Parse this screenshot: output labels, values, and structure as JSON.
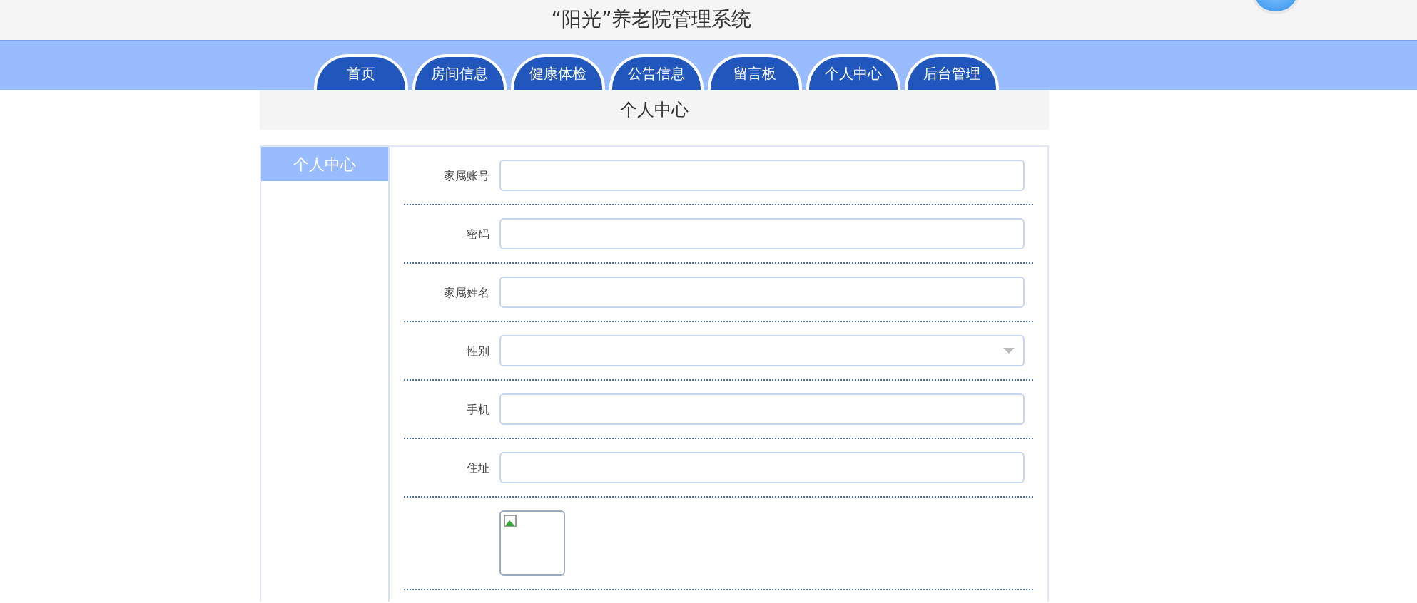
{
  "header": {
    "title": "“阳光”养老院管理系统"
  },
  "nav": {
    "tabs": [
      {
        "label": "首页"
      },
      {
        "label": "房间信息"
      },
      {
        "label": "健康体检"
      },
      {
        "label": "公告信息"
      },
      {
        "label": "留言板"
      },
      {
        "label": "个人中心"
      },
      {
        "label": "后台管理"
      }
    ]
  },
  "page_title": "个人中心",
  "sidebar": {
    "heading": "个人中心"
  },
  "form": {
    "fields": [
      {
        "label": "家属账号",
        "kind": "input"
      },
      {
        "label": "密码",
        "kind": "input"
      },
      {
        "label": "家属姓名",
        "kind": "input"
      },
      {
        "label": "性别",
        "kind": "select"
      },
      {
        "label": "手机",
        "kind": "input"
      },
      {
        "label": "住址",
        "kind": "input"
      },
      {
        "kind": "image"
      }
    ]
  }
}
